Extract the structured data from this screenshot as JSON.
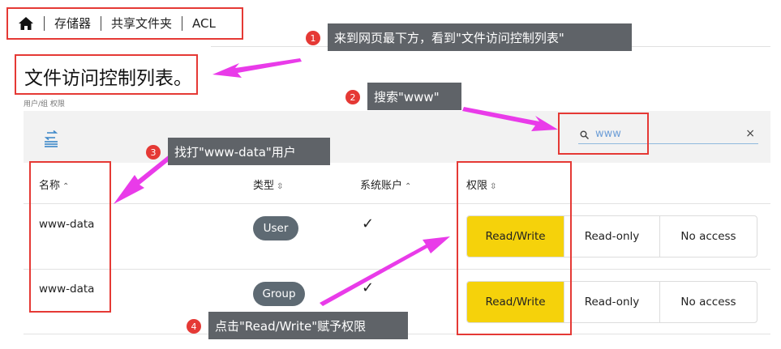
{
  "breadcrumb": {
    "items": [
      "存储器",
      "共享文件夹",
      "ACL"
    ]
  },
  "page": {
    "title": "文件访问控制列表。",
    "subtitle": "用户/组 权限"
  },
  "search": {
    "value": "www",
    "clear_glyph": "×"
  },
  "table": {
    "columns": [
      "名称",
      "类型",
      "系统账户",
      "权限"
    ],
    "rows": [
      {
        "name": "www-data",
        "type": "User",
        "system_account": true,
        "permission": "Read/Write"
      },
      {
        "name": "www-data",
        "type": "Group",
        "system_account": true,
        "permission": "Read/Write"
      }
    ],
    "permission_options": [
      "Read/Write",
      "Read-only",
      "No access"
    ]
  },
  "annotations": [
    {
      "number": "1",
      "text": "来到网页最下方，看到\"文件访问控制列表\""
    },
    {
      "number": "2",
      "text": "搜索\"www\""
    },
    {
      "number": "3",
      "text": "找打\"www-data\"用户"
    },
    {
      "number": "4",
      "text": "点击\"Read/Write\"赋予权限"
    }
  ],
  "colors": {
    "highlight": "#e53935",
    "arrow": "#e93be9",
    "active": "#f5d20b",
    "callout": "#5f6368",
    "pill": "#5e6a73"
  },
  "icons": [
    "home-icon",
    "search-icon",
    "close-icon",
    "switch-view-icon",
    "checkmark-icon",
    "sort-icon"
  ]
}
